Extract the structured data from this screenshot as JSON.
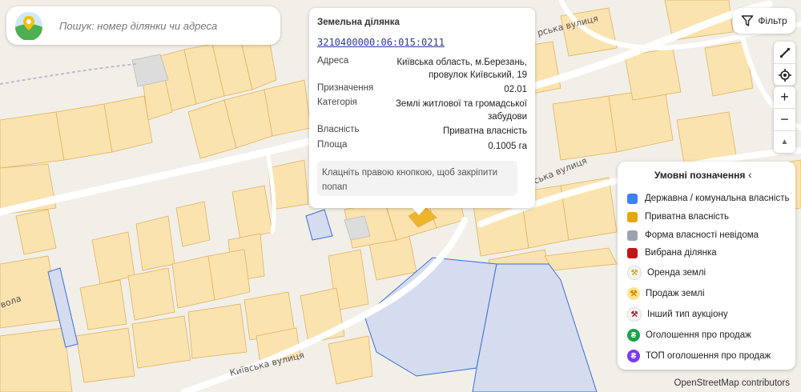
{
  "search": {
    "placeholder": "Пошук: номер ділянки чи адреса"
  },
  "filter": {
    "label": "Фільтр",
    "icon": "filter-icon"
  },
  "controls": {
    "ruler_icon": "ruler-icon",
    "locate_icon": "locate-icon",
    "zoom_in": "+",
    "zoom_out": "−",
    "compass": "▲"
  },
  "popup": {
    "title": "Земельна ділянка",
    "cadastral": "3210400000:06:015:0211",
    "address_label": "Адреса",
    "address_value": "Київська область, м.Березань, провулок Київський, 19",
    "purpose_label": "Призначення",
    "purpose_value": "02.01",
    "category_label": "Категорія",
    "category_value": "Землі житлової та громадської забудови",
    "ownership_label": "Власність",
    "ownership_value": "Приватна власність",
    "area_label": "Площа",
    "area_value": "0.1005 га",
    "hint": "Клацніть правою кнопкою, щоб закріпити попап"
  },
  "legend": {
    "title": "Умовні позначення",
    "collapse_icon": "chevron-left-icon",
    "items": [
      {
        "label": "Державна / комунальна власність",
        "color": "#3b82f6"
      },
      {
        "label": "Приватна власність",
        "color": "#e8a317"
      },
      {
        "label": "Форма власності невідома",
        "color": "#9ca3af"
      },
      {
        "label": "Вибрана ділянка",
        "color": "#c0161b"
      }
    ],
    "auctions": [
      {
        "label": "Оренда землі",
        "color": "#f3f4f6",
        "glyph": "⚒",
        "glyph_color": "#e8a317"
      },
      {
        "label": "Продаж землі",
        "color": "#fde68a",
        "glyph": "⚒",
        "glyph_color": "#d97706"
      },
      {
        "label": "Інший тип аукціону",
        "color": "#f3f4f6",
        "glyph": "⚒",
        "glyph_color": "#c0161b"
      },
      {
        "label": "Оголошення про продаж",
        "color": "#16a34a",
        "glyph": "₴",
        "glyph_color": "#ffffff"
      },
      {
        "label": "ТОП оголошення про продаж",
        "color": "#7c3aed",
        "glyph": "₴",
        "glyph_color": "#ffffff"
      }
    ]
  },
  "map": {
    "streets": [
      "Київська вулиця",
      "Київська вулиця",
      "ська вулиця",
      "рська вулиця",
      "вола"
    ],
    "colors": {
      "private": "#fbe3b0",
      "private_border": "#e0b35a",
      "state": "#d5dcef",
      "state_border": "#3b6fd6",
      "unknown": "#dcdcdc"
    }
  },
  "attribution": "OpenStreetMap contributors"
}
